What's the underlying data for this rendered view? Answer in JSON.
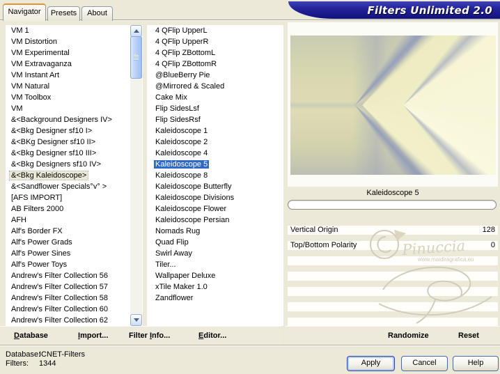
{
  "window_title": "Filters Unlimited 2.0",
  "tabs": {
    "navigator": "Navigator",
    "presets": "Presets",
    "about": "About"
  },
  "category_list": {
    "selected_index": 13,
    "items": [
      "VM 1",
      "VM Distortion",
      "VM Experimental",
      "VM Extravaganza",
      "VM Instant Art",
      "VM Natural",
      "VM Toolbox",
      "VM",
      "&<Background Designers IV>",
      "&<Bkg Designer sf10 I>",
      "&<BKg Designer sf10 II>",
      "&<Bkg Designer sf10 III>",
      "&<Bkg Designers sf10 IV>",
      "&<Bkg Kaleidoscope>",
      "&<Sandflower Specials°v° >",
      "[AFS IMPORT]",
      "AB Filters 2000",
      "AFH",
      "Alf's Border FX",
      "Alf's Power Grads",
      "Alf's Power Sines",
      "Alf's Power Toys",
      "Andrew's Filter Collection 56",
      "Andrew's Filter Collection 57",
      "Andrew's Filter Collection 58",
      "Andrew's Filter Collection 60",
      "Andrew's Filter Collection 62"
    ]
  },
  "filter_list": {
    "selected_index": 12,
    "items": [
      "4 QFlip UpperL",
      "4 QFlip UpperR",
      "4 QFlip ZBottomL",
      "4 QFlip ZBottomR",
      "@BlueBerry Pie",
      "@Mirrored & Scaled",
      "Cake Mix",
      "Flip SidesLsf",
      "Flip SidesRsf",
      "Kaleidoscope 1",
      "Kaleidoscope 2",
      "Kaleidoscope 4",
      "Kaleidoscope 5",
      "Kaleidoscope 8",
      "Kaleidoscope Butterfly",
      "Kaleidoscope Divisions",
      "Kaleidoscope Flower",
      "Kaleidoscope Persian",
      "Nomads Rug",
      "Quad Flip",
      "Swirl Away",
      "Tiler...",
      "Wallpaper Deluxe",
      "xTile Maker 1.0",
      "Zandflower"
    ]
  },
  "preview_caption": "Kaleidoscope 5",
  "params": {
    "rows": [
      {
        "label": "Vertical Origin",
        "value": "128"
      },
      {
        "label": "Top/Bottom Polarity",
        "value": "0"
      }
    ]
  },
  "toolbar": {
    "database": {
      "pre": "",
      "key": "D",
      "post": "atabase"
    },
    "import": {
      "pre": "",
      "key": "I",
      "post": "mport..."
    },
    "filter_info": {
      "pre": "Filter ",
      "key": "I",
      "post": "nfo..."
    },
    "editor": {
      "pre": "",
      "key": "E",
      "post": "ditor..."
    },
    "randomize": "Randomize",
    "reset": "Reset"
  },
  "status": {
    "database_label": "Database:",
    "database_value": "ICNET-Filters",
    "filters_label": "Filters:",
    "filters_value": "1344"
  },
  "buttons": {
    "apply": "Apply",
    "cancel": "Cancel",
    "help": "Help"
  },
  "watermark": {
    "name": "Pinuccia",
    "url": "www.maidiragrafica.eu"
  },
  "colors": {
    "dialog_bg": "#ece9d8",
    "selection_blue": "#316ac5",
    "title_navy": "#1b1b8e",
    "tab_accent_orange": "#e78f33",
    "scrollbar_blue": "#b6cef7"
  }
}
